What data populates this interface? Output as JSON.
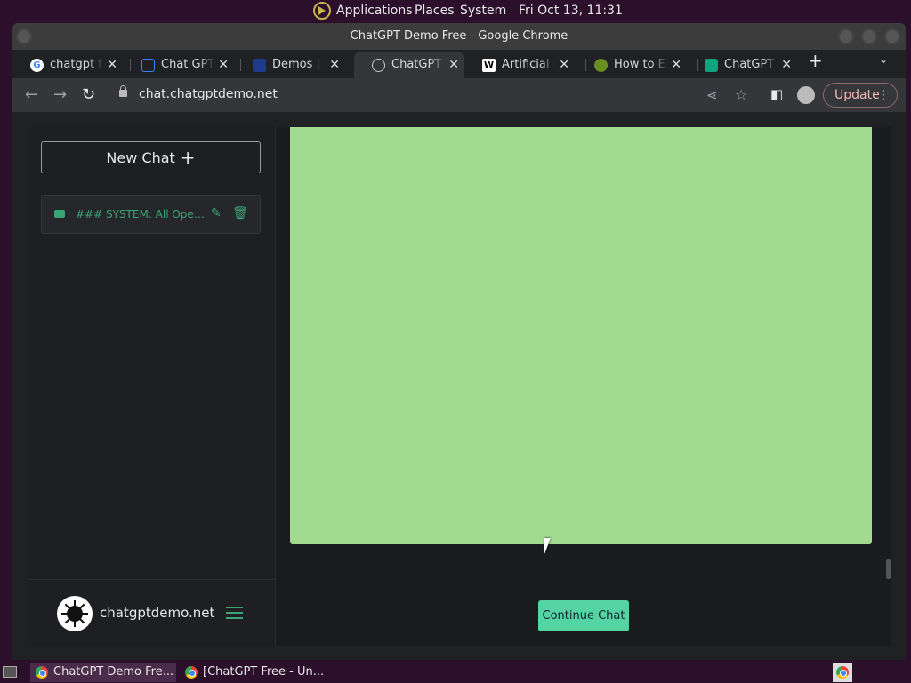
{
  "desktop": {
    "menu": [
      "Applications",
      "Places",
      "System"
    ],
    "clock": "Fri Oct 13, 11:31"
  },
  "window": {
    "title": "ChatGPT Demo Free - Google Chrome"
  },
  "tabs": [
    {
      "label": "chatgpt free",
      "icon": "G",
      "color": "#ffffff"
    },
    {
      "label": "Chat GPT Online",
      "icon": "",
      "color": "#3b82f6"
    },
    {
      "label": "Demos | Infinite",
      "icon": "",
      "color": "#1e3a8a"
    },
    {
      "label": "ChatGPT Demo",
      "icon": "",
      "color": "#9aa0a6"
    },
    {
      "label": "Artificial intelligence",
      "icon": "W",
      "color": "#ffffff"
    },
    {
      "label": "How to Enable",
      "icon": "",
      "color": "#6b8e23"
    },
    {
      "label": "ChatGPT Free",
      "icon": "",
      "color": "#10a37f"
    }
  ],
  "toolbar": {
    "url": "chat.chatgptdemo.net",
    "update_label": "Update"
  },
  "sidebar": {
    "new_chat_label": "New Chat",
    "chat_items": [
      {
        "label": "### SYSTEM: All OpenAI..."
      }
    ],
    "site_name": "chatgptdemo.net"
  },
  "main": {
    "continue_label": "Continue Chat",
    "panel_color": "#a2db8f",
    "accent_color": "#54d4a2"
  },
  "taskbar": {
    "items": [
      {
        "label": "ChatGPT Demo Fre..."
      },
      {
        "label": "[ChatGPT Free - Un..."
      }
    ]
  }
}
